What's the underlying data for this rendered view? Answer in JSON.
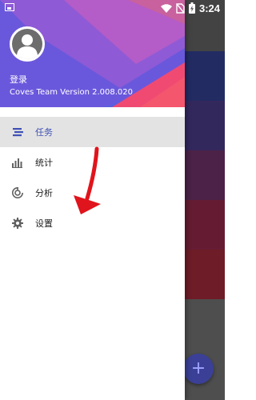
{
  "status_bar": {
    "time": "3:24",
    "icons": [
      "image-icon",
      "wifi-icon",
      "no-sim-icon",
      "battery-charging-icon"
    ]
  },
  "drawer": {
    "header": {
      "login": "登录",
      "version": "Coves Team Version 2.008.020"
    },
    "menu": [
      {
        "label": "任务",
        "icon": "tasks-icon",
        "selected": true
      },
      {
        "label": "统计",
        "icon": "bar-chart-icon",
        "selected": false
      },
      {
        "label": "分析",
        "icon": "analysis-icon",
        "selected": false
      },
      {
        "label": "设置",
        "icon": "gear-icon",
        "selected": false
      }
    ]
  },
  "fab": {
    "label": "+"
  },
  "colors": {
    "accent": "#3f51b5",
    "header_blue": "#5b5fe0",
    "header_purple": "#9b5bd0",
    "header_pink": "#e0457e",
    "arrow": "#e0141c"
  }
}
